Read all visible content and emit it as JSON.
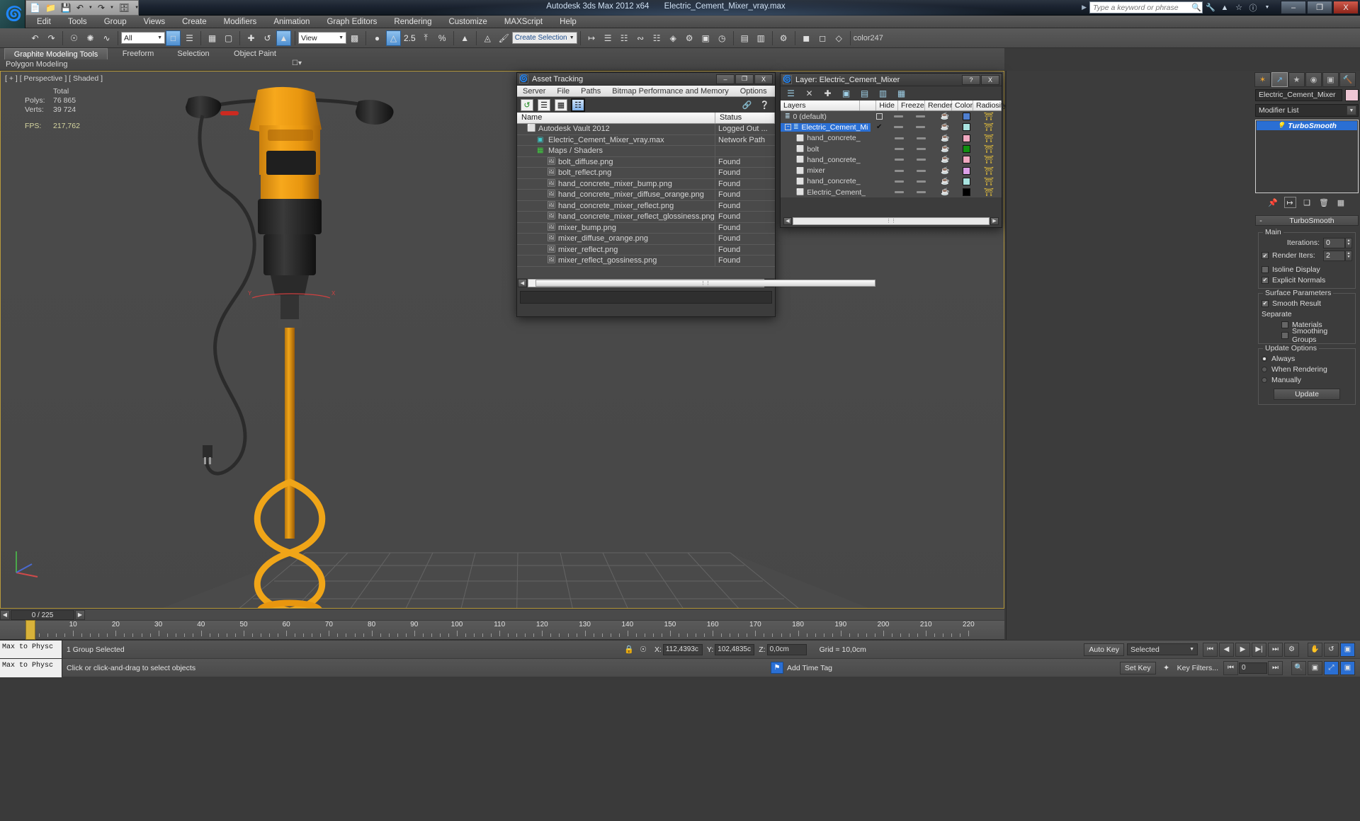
{
  "titlebar": {
    "app_title": "Autodesk 3ds Max  2012 x64",
    "file_name": "Electric_Cement_Mixer_vray.max",
    "search_placeholder": "Type a keyword or phrase",
    "icons": [
      "binoculars-icon",
      "wrench-icon",
      "cone-icon",
      "star-icon",
      "help-icon"
    ],
    "minimize": "–",
    "maximize": "❐",
    "close": "X"
  },
  "menubar": {
    "items": [
      "Edit",
      "Tools",
      "Group",
      "Views",
      "Create",
      "Modifiers",
      "Animation",
      "Graph Editors",
      "Rendering",
      "Customize",
      "MAXScript",
      "Help"
    ]
  },
  "toolbar": {
    "selection_filter": "All",
    "reference_coord": "View",
    "angle_snap_value": "2.5",
    "named_selection_sets": "Create Selection Se",
    "color_label": "color247"
  },
  "ribbon": {
    "tabs": [
      "Graphite Modeling Tools",
      "Freeform",
      "Selection",
      "Object Paint"
    ],
    "active_tab": "Graphite Modeling Tools",
    "subtab": "Polygon Modeling"
  },
  "viewport": {
    "label": "[ + ] [ Perspective ] [ Shaded ]",
    "stats": {
      "total_label": "Total",
      "polys_label": "Polys:",
      "polys_value": "76 865",
      "verts_label": "Verts:",
      "verts_value": "39 724",
      "fps_label": "FPS:",
      "fps_value": "217,762"
    },
    "ruler_labels": [
      "10",
      "20",
      "30",
      "40",
      "50",
      "60",
      "70",
      "80",
      "90",
      "100",
      "110",
      "120",
      "130",
      "140",
      "150",
      "160",
      "170",
      "180",
      "190",
      "200",
      "210",
      "220"
    ]
  },
  "trackbar": {
    "frame_field": "0 / 225",
    "left_arrow": "◀",
    "right_arrow": "▶"
  },
  "maxscript": {
    "line1": "Max to Physc",
    "line2": "Max to Physc"
  },
  "statusbar": {
    "selection_text": "1 Group Selected",
    "hint_text": "Click or click-and-drag to select objects",
    "lock_icon": "lock-icon",
    "coord_icon": "absolute-relative-icon",
    "x_label": "X:",
    "x_value": "112,4393c",
    "y_label": "Y:",
    "y_value": "102,4835c",
    "z_label": "Z:",
    "z_value": "0,0cm",
    "grid_text": "Grid = 10,0cm",
    "add_time_tag": "Add Time Tag",
    "auto_key": "Auto Key",
    "set_key": "Set Key",
    "selected_dropdown": "Selected",
    "key_filters": "Key Filters...",
    "key_field": "0"
  },
  "asset_tracking": {
    "title": "Asset Tracking",
    "menu": [
      "Server",
      "File",
      "Paths",
      "Bitmap Performance and Memory",
      "Options"
    ],
    "toolbar_icons": [
      "refresh-icon",
      "list-view-icon",
      "detail-view-icon",
      "table-view-icon"
    ],
    "help_icons": [
      "help-web-icon",
      "help-icon"
    ],
    "columns": [
      "Name",
      "Status"
    ],
    "minimize": "–",
    "maximize": "❐",
    "close": "X",
    "rows": [
      {
        "name": "Autodesk Vault 2012",
        "status": "Logged Out ...",
        "indent": 0,
        "icon": "vault-icon"
      },
      {
        "name": "Electric_Cement_Mixer_vray.max",
        "status": "Network Path",
        "indent": 1,
        "icon": "max-file-icon"
      },
      {
        "name": "Maps / Shaders",
        "status": "",
        "indent": 1,
        "icon": "maps-icon"
      },
      {
        "name": "bolt_diffuse.png",
        "status": "Found",
        "indent": 2,
        "icon": "bitmap-icon"
      },
      {
        "name": "bolt_reflect.png",
        "status": "Found",
        "indent": 2,
        "icon": "bitmap-icon"
      },
      {
        "name": "hand_concrete_mixer_bump.png",
        "status": "Found",
        "indent": 2,
        "icon": "bitmap-icon"
      },
      {
        "name": "hand_concrete_mixer_diffuse_orange.png",
        "status": "Found",
        "indent": 2,
        "icon": "bitmap-icon"
      },
      {
        "name": "hand_concrete_mixer_reflect.png",
        "status": "Found",
        "indent": 2,
        "icon": "bitmap-icon"
      },
      {
        "name": "hand_concrete_mixer_reflect_glossiness.png",
        "status": "Found",
        "indent": 2,
        "icon": "bitmap-icon"
      },
      {
        "name": "mixer_bump.png",
        "status": "Found",
        "indent": 2,
        "icon": "bitmap-icon"
      },
      {
        "name": "mixer_diffuse_orange.png",
        "status": "Found",
        "indent": 2,
        "icon": "bitmap-icon"
      },
      {
        "name": "mixer_reflect.png",
        "status": "Found",
        "indent": 2,
        "icon": "bitmap-icon"
      },
      {
        "name": "mixer_reflect_gossiness.png",
        "status": "Found",
        "indent": 2,
        "icon": "bitmap-icon"
      }
    ],
    "scroll_thumb_glyph": "⋮⋮"
  },
  "layer_dialog": {
    "title": "Layer: Electric_Cement_Mixer",
    "help_btn": "?",
    "close_btn": "X",
    "toolbar_icons": [
      "new-layer-icon",
      "delete-layer-icon",
      "add-selection-icon",
      "select-objects-icon",
      "select-highlighted-icon",
      "highlight-selected-icon",
      "layer-properties-icon"
    ],
    "columns": [
      "Layers",
      "",
      "Hide",
      "Freeze",
      "Render",
      "Color",
      "Radiosity"
    ],
    "rows": [
      {
        "name": "0 (default)",
        "indent": 0,
        "current": false,
        "checkbox": true,
        "color": "#4f7fd0",
        "selected": false
      },
      {
        "name": "Electric_Cement_Mi",
        "indent": 0,
        "current": true,
        "checkbox": false,
        "color": "#a9e4e0",
        "selected": true
      },
      {
        "name": "hand_concrete_",
        "indent": 1,
        "current": false,
        "checkbox": false,
        "color": "#efa8c0",
        "selected": false
      },
      {
        "name": "bolt",
        "indent": 1,
        "current": false,
        "checkbox": false,
        "color": "#109010",
        "selected": false
      },
      {
        "name": "hand_concrete_",
        "indent": 1,
        "current": false,
        "checkbox": false,
        "color": "#efa8c0",
        "selected": false
      },
      {
        "name": "mixer",
        "indent": 1,
        "current": false,
        "checkbox": false,
        "color": "#dca0e8",
        "selected": false
      },
      {
        "name": "hand_concrete_",
        "indent": 1,
        "current": false,
        "checkbox": false,
        "color": "#a9e4e0",
        "selected": false
      },
      {
        "name": "Electric_Cement_",
        "indent": 1,
        "current": false,
        "checkbox": false,
        "color": "#000000",
        "selected": false
      }
    ],
    "scroll_thumb_glyph": "⋮⋮"
  },
  "command_panel": {
    "tabs": [
      "create-tab-icon",
      "modify-tab-icon",
      "hierarchy-tab-icon",
      "motion-tab-icon",
      "display-tab-icon",
      "utilities-tab-icon"
    ],
    "active_tab_index": 1,
    "object_name": "Electric_Cement_Mixer",
    "object_color": "#efc7d5",
    "modifier_list_label": "Modifier List",
    "modifier_stack": [
      {
        "name": "TurboSmooth",
        "icon": "light-bulb-icon",
        "selected": true
      }
    ],
    "stack_icons": [
      "pin-stack-icon",
      "show-end-result-icon",
      "make-unique-icon",
      "remove-modifier-icon",
      "configure-sets-icon"
    ],
    "rollout": {
      "title": "TurboSmooth",
      "collapse_glyph": "-",
      "main_group": "Main",
      "iterations_label": "Iterations:",
      "iterations_value": "0",
      "render_iters_label": "Render Iters:",
      "render_iters_checked": true,
      "render_iters_value": "2",
      "isoline_display_label": "Isoline Display",
      "isoline_display_checked": false,
      "explicit_normals_label": "Explicit Normals",
      "explicit_normals_checked": true,
      "surface_params_group": "Surface Parameters",
      "smooth_result_label": "Smooth Result",
      "smooth_result_checked": true,
      "separate_label": "Separate",
      "materials_label": "Materials",
      "materials_checked": false,
      "smoothing_groups_label": "Smoothing Groups",
      "smoothing_groups_checked": false,
      "update_options_group": "Update Options",
      "update_always_label": "Always",
      "update_when_rendering_label": "When Rendering",
      "update_manually_label": "Manually",
      "update_selected": "Always",
      "update_button": "Update"
    }
  }
}
